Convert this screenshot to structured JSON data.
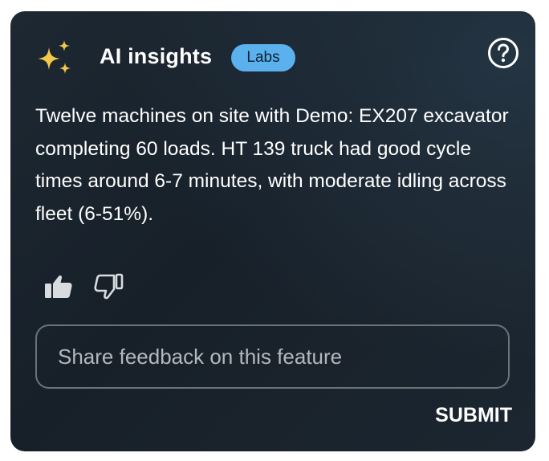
{
  "header": {
    "title": "AI insights",
    "badge": "Labs",
    "icon": "sparkle-icon",
    "help_icon": "help-circle-icon"
  },
  "insight": {
    "text": "Twelve machines on site with Demo: EX207 excavator completing 60 loads. HT 139 truck had good cycle times around 6-7 minutes, with moderate idling across fleet (6-51%)."
  },
  "feedback": {
    "thumbs_up_icon": "thumbs-up-icon",
    "thumbs_down_icon": "thumbs-down-icon",
    "placeholder": "Share feedback on this feature",
    "value": "",
    "submit_label": "SUBMIT"
  },
  "colors": {
    "card_background": "#1b252e",
    "accent_sparkle": "#f3c74a",
    "badge_background": "#5bb0ee",
    "badge_text": "#0e2233",
    "input_border": "#6b7379"
  }
}
